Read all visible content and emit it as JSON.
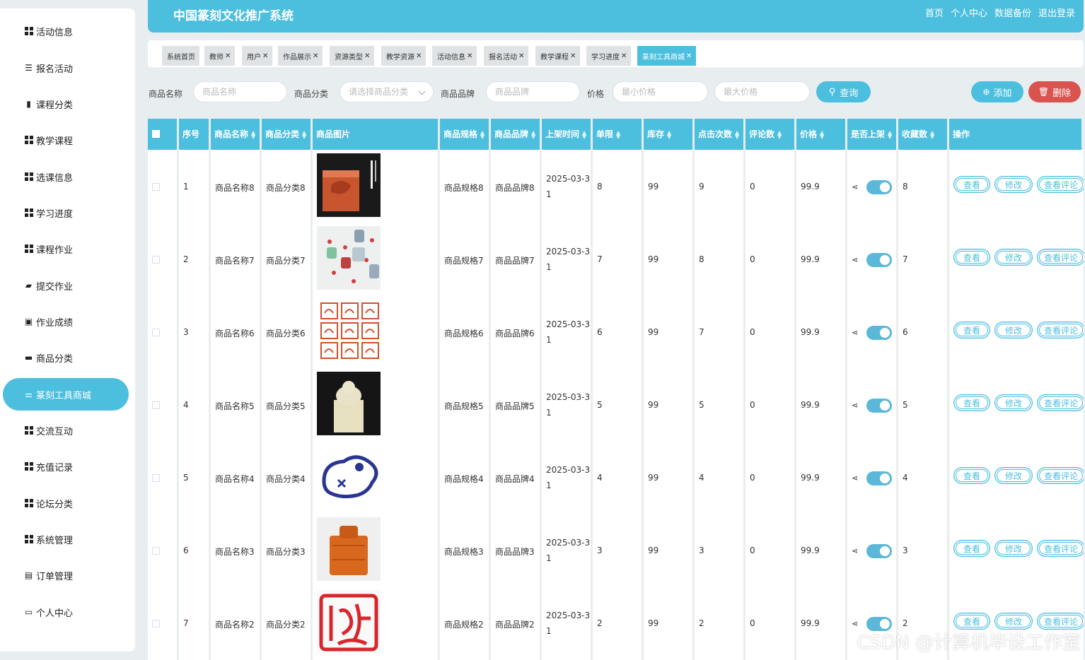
{
  "header": {
    "title": "中国篆刻文化推广系统",
    "links": [
      "首页",
      "个人中心",
      "数据备份",
      "退出登录"
    ]
  },
  "sidebar": {
    "items": [
      {
        "label": "活动信息",
        "icon": "grid-icon"
      },
      {
        "label": "报名活动",
        "icon": "list-icon"
      },
      {
        "label": "课程分类",
        "icon": "chart-icon"
      },
      {
        "label": "教学课程",
        "icon": "apps-icon"
      },
      {
        "label": "选课信息",
        "icon": "grid-icon"
      },
      {
        "label": "学习进度",
        "icon": "grid-icon"
      },
      {
        "label": "课程作业",
        "icon": "grid-icon"
      },
      {
        "label": "提交作业",
        "icon": "folder-icon"
      },
      {
        "label": "作业成绩",
        "icon": "message-icon"
      },
      {
        "label": "商品分类",
        "icon": "monitor-icon"
      },
      {
        "label": "篆刻工具商城",
        "icon": "sliders-icon",
        "active": true
      },
      {
        "label": "交流互动",
        "icon": "grid-icon"
      },
      {
        "label": "充值记录",
        "icon": "grid-icon"
      },
      {
        "label": "论坛分类",
        "icon": "grid-icon"
      },
      {
        "label": "系统管理",
        "icon": "grid-icon"
      },
      {
        "label": "订单管理",
        "icon": "clipboard-icon"
      },
      {
        "label": "个人中心",
        "icon": "calendar-icon"
      }
    ]
  },
  "tabs": [
    {
      "label": "系统首页",
      "closable": false
    },
    {
      "label": "教师",
      "closable": true
    },
    {
      "label": "用户",
      "closable": true
    },
    {
      "label": "作品展示",
      "closable": true
    },
    {
      "label": "资源类型",
      "closable": true
    },
    {
      "label": "教学资源",
      "closable": true
    },
    {
      "label": "活动信息",
      "closable": true
    },
    {
      "label": "报名活动",
      "closable": true
    },
    {
      "label": "教学课程",
      "closable": true
    },
    {
      "label": "学习进度",
      "closable": true
    },
    {
      "label": "篆刻工具商城",
      "closable": true,
      "active": true
    }
  ],
  "search": {
    "name_label": "商品名称",
    "name_placeholder": "商品名称",
    "category_label": "商品分类",
    "category_placeholder": "请选择商品分类",
    "brand_label": "商品品牌",
    "brand_placeholder": "商品品牌",
    "price_label": "价格",
    "min_price_placeholder": "最小价格",
    "max_price_placeholder": "最大价格",
    "query_button": "查询",
    "add_button": "添加",
    "delete_button": "删除"
  },
  "table": {
    "columns": [
      "序号",
      "商品名称",
      "商品分类",
      "商品图片",
      "商品规格",
      "商品品牌",
      "上架时间",
      "单限",
      "库存",
      "点击次数",
      "评论数",
      "价格",
      "是否上架",
      "收藏数",
      "操作"
    ],
    "actions": [
      "查看",
      "修改",
      "查看评论"
    ],
    "rows": [
      {
        "no": "1",
        "name": "商品名称8",
        "category": "商品分类8",
        "spec": "商品规格8",
        "brand": "商品品牌8",
        "time1": "2025-03-3",
        "time2": "1",
        "limit": "8",
        "stock": "99",
        "clicks": "9",
        "comments": "0",
        "price": "99.9",
        "on_sale": true,
        "favorites": "8",
        "image": "red-seal-box"
      },
      {
        "no": "2",
        "name": "商品名称7",
        "category": "商品分类7",
        "spec": "商品规格7",
        "brand": "商品品牌7",
        "time1": "2025-03-3",
        "time2": "1",
        "limit": "7",
        "stock": "99",
        "clicks": "8",
        "comments": "0",
        "price": "99.9",
        "on_sale": true,
        "favorites": "7",
        "image": "stamps-group"
      },
      {
        "no": "3",
        "name": "商品名称6",
        "category": "商品分类6",
        "spec": "商品规格6",
        "brand": "商品品牌6",
        "time1": "2025-03-3",
        "time2": "1",
        "limit": "6",
        "stock": "99",
        "clicks": "7",
        "comments": "0",
        "price": "99.9",
        "on_sale": true,
        "favorites": "6",
        "image": "zodiac-seals"
      },
      {
        "no": "4",
        "name": "商品名称5",
        "category": "商品分类5",
        "spec": "商品规格5",
        "brand": "商品品牌5",
        "time1": "2025-03-3",
        "time2": "1",
        "limit": "5",
        "stock": "99",
        "clicks": "5",
        "comments": "0",
        "price": "99.9",
        "on_sale": true,
        "favorites": "5",
        "image": "jade-lion-seal"
      },
      {
        "no": "5",
        "name": "商品名称4",
        "category": "商品分类4",
        "spec": "商品规格4",
        "brand": "商品品牌4",
        "time1": "2025-03-3",
        "time2": "1",
        "limit": "4",
        "stock": "99",
        "clicks": "4",
        "comments": "0",
        "price": "99.9",
        "on_sale": true,
        "favorites": "4",
        "image": "blue-dog-stamp"
      },
      {
        "no": "6",
        "name": "商品名称3",
        "category": "商品分类3",
        "spec": "商品规格3",
        "brand": "商品品牌3",
        "time1": "2025-03-3",
        "time2": "1",
        "limit": "3",
        "stock": "99",
        "clicks": "3",
        "comments": "0",
        "price": "99.9",
        "on_sale": true,
        "favorites": "3",
        "image": "orange-stone-seal"
      },
      {
        "no": "7",
        "name": "商品名称2",
        "category": "商品分类2",
        "spec": "商品规格2",
        "brand": "商品品牌2",
        "time1": "2025-03-3",
        "time2": "1",
        "limit": "2",
        "stock": "99",
        "clicks": "2",
        "comments": "0",
        "price": "99.9",
        "on_sale": true,
        "favorites": "2",
        "image": "red-calligraphy-seal"
      }
    ]
  },
  "watermark": "CSDN @计算机毕设工作室",
  "colors": {
    "accent": "#4dbfde",
    "danger": "#d9534f",
    "background": "#e8eef0"
  }
}
